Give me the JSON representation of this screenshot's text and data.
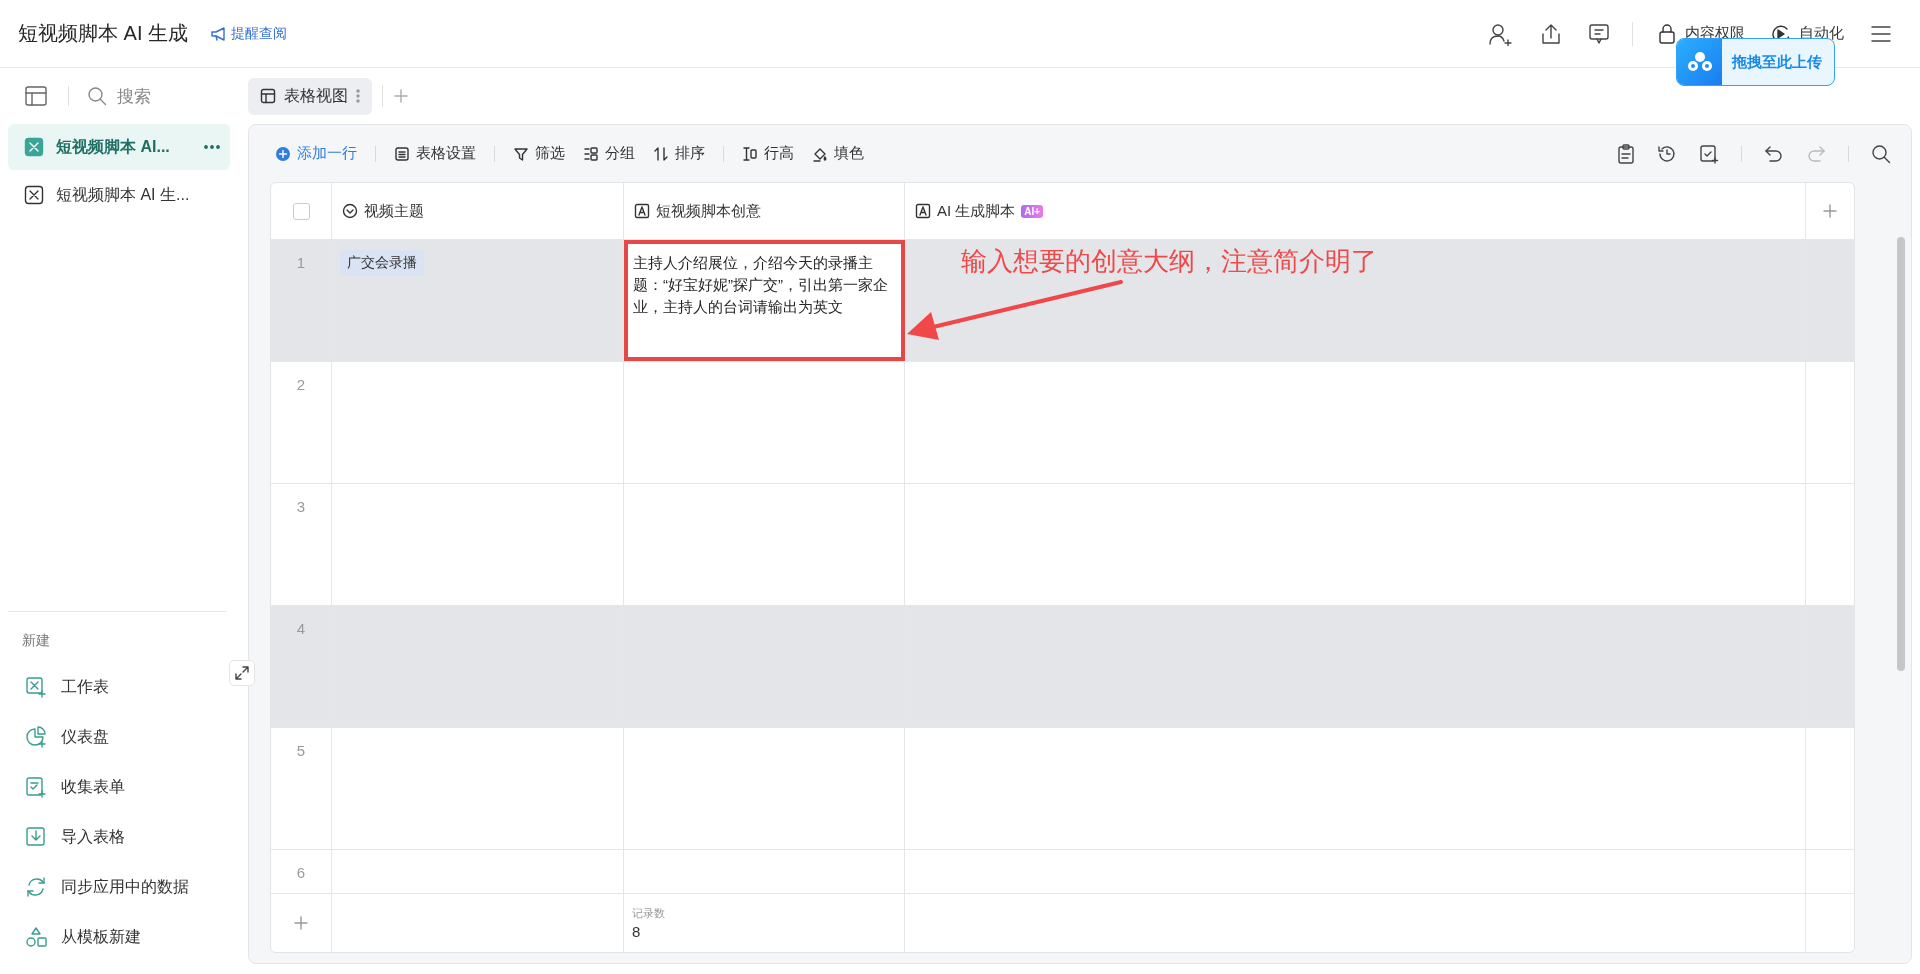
{
  "topbar": {
    "title": "短视频脚本 AI 生成",
    "reminder": "提醒查阅",
    "actions": [
      {
        "kind": "permission",
        "label": "内容权限"
      },
      {
        "kind": "automation",
        "label": "自动化"
      }
    ]
  },
  "upload_badge": {
    "label": "拖拽至此上传"
  },
  "sidebar": {
    "search_placeholder": "搜索",
    "items": [
      {
        "label": "短视频脚本 AI...",
        "selected": true
      },
      {
        "label": "短视频脚本 AI 生...",
        "selected": false
      }
    ],
    "new_section": {
      "title": "新建",
      "items": [
        {
          "kind": "sheet",
          "label": "工作表"
        },
        {
          "kind": "dashboard",
          "label": "仪表盘"
        },
        {
          "kind": "form",
          "label": "收集表单"
        },
        {
          "kind": "import",
          "label": "导入表格"
        },
        {
          "kind": "sync",
          "label": "同步应用中的数据"
        },
        {
          "kind": "template",
          "label": "从模板新建"
        }
      ]
    }
  },
  "tabs": [
    {
      "label": "表格视图",
      "selected": true
    }
  ],
  "toolbar": [
    {
      "kind": "add",
      "label": "添加一行"
    },
    {
      "kind": "settings",
      "label": "表格设置"
    },
    {
      "kind": "filter",
      "label": "筛选"
    },
    {
      "kind": "group",
      "label": "分组"
    },
    {
      "kind": "sort",
      "label": "排序"
    },
    {
      "kind": "height",
      "label": "行高"
    },
    {
      "kind": "fill",
      "label": "填色"
    }
  ],
  "table": {
    "select_all_checked": false,
    "columns": [
      {
        "kind": "select",
        "title": "视频主题"
      },
      {
        "kind": "text",
        "title": "短视频脚本创意"
      },
      {
        "kind": "text",
        "title": "AI 生成脚本",
        "badge": "AI+"
      }
    ],
    "rows": [
      {
        "number": "1",
        "highlighted": true,
        "topic": "广交会录播",
        "idea": "主持人介绍展位，介绍今天的录播主题：“好宝好妮”探广交”，引出第一家企业，主持人的台词请输出为英文",
        "idea_outlined": true
      },
      {
        "number": "2",
        "highlighted": false,
        "idea_outlined": false
      },
      {
        "number": "3",
        "highlighted": false,
        "idea_outlined": false
      },
      {
        "number": "4",
        "highlighted": true,
        "idea_outlined": false
      },
      {
        "number": "5",
        "highlighted": false,
        "idea_outlined": false
      },
      {
        "number": "6",
        "highlighted": false,
        "idea_outlined": false
      }
    ],
    "footer": {
      "label": "记录数",
      "value": "8"
    }
  },
  "annotation": {
    "text": "输入想要的创意大纲，注意简介明了"
  }
}
